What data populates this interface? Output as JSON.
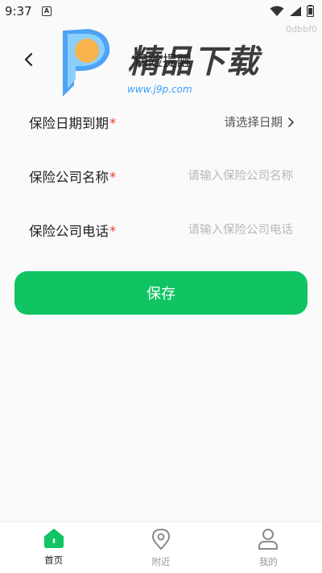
{
  "status_bar": {
    "time": "9:37",
    "notification_glyph": "A",
    "icons": [
      "wifi-icon",
      "signal-icon",
      "battery-icon"
    ]
  },
  "build_id": "0dbbf0",
  "header": {
    "title": "保险提醒",
    "back_icon": "chevron-left-icon"
  },
  "watermark": {
    "brand": "精品下载",
    "url": "www.j9p.com"
  },
  "form": {
    "expiry": {
      "label": "保险日期到期",
      "required_mark": "*",
      "picker_text": "请选择日期"
    },
    "company_name": {
      "label": "保险公司名称",
      "required_mark": "*",
      "value": "",
      "placeholder": "请输入保险公司名称"
    },
    "company_phone": {
      "label": "保险公司电话",
      "required_mark": "*",
      "value": "",
      "placeholder": "请输入保险公司电话"
    }
  },
  "save_button": {
    "label": "保存"
  },
  "tabbar": {
    "active": "home",
    "items": [
      {
        "id": "home",
        "label": "首页",
        "icon": "home-icon"
      },
      {
        "id": "nearby",
        "label": "附近",
        "icon": "location-pin-icon"
      },
      {
        "id": "mine",
        "label": "我的",
        "icon": "person-icon"
      }
    ]
  },
  "colors": {
    "accent": "#10c464",
    "required": "#e5452e",
    "placeholder": "#b8b8b8"
  }
}
